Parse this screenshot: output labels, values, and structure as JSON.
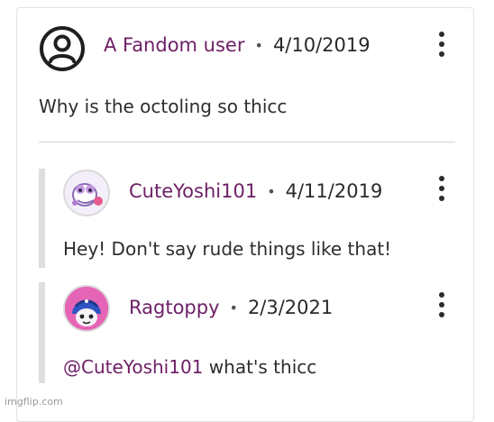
{
  "main_comment": {
    "author": "A Fandom user",
    "date": "4/10/2019",
    "text": "Why is the octoling so thicc",
    "avatar_icon": "user-circle-icon"
  },
  "replies": [
    {
      "author": "CuteYoshi101",
      "date": "4/11/2019",
      "text": "Hey! Don't say rude things like that!"
    },
    {
      "author": "Ragtoppy",
      "date": "2/3/2021",
      "mention": "@CuteYoshi101",
      "text": " what's thicc"
    }
  ],
  "separator": "•",
  "menu_icon": "more-vertical-icon",
  "watermark": "imgflip.com",
  "colors": {
    "username": "#6e2066",
    "divider": "#d4d4d4",
    "reply_bar": "#dedede"
  }
}
